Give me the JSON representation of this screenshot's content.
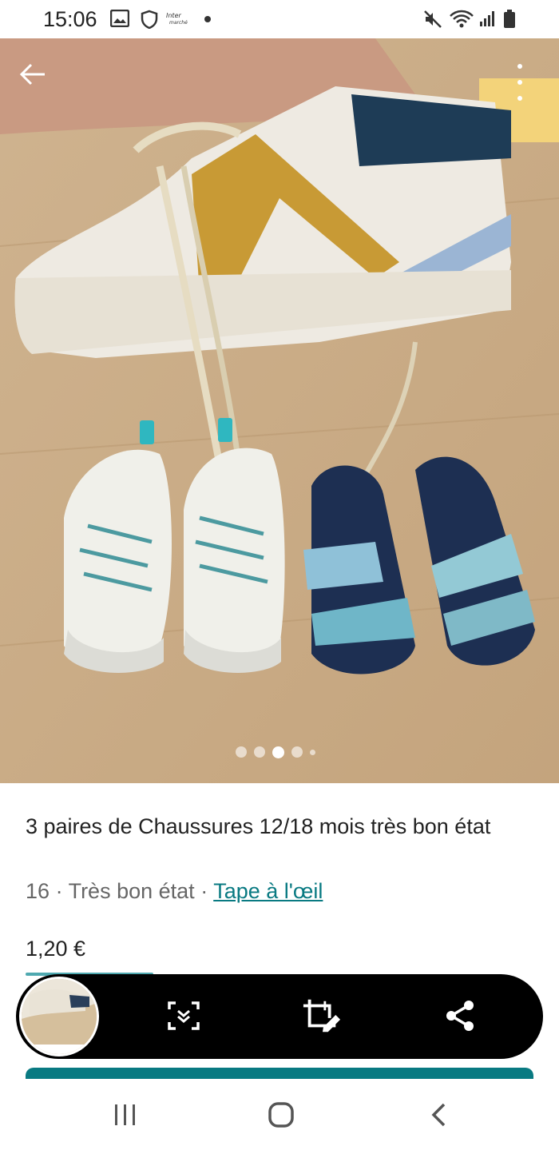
{
  "status_bar": {
    "time": "15:06",
    "icons": [
      "gallery-icon",
      "shield-icon",
      "intermarche-icon",
      "notification-dot",
      "mute-icon",
      "wifi-icon",
      "signal-icon",
      "battery-icon"
    ]
  },
  "photo": {
    "subject": "baby shoes",
    "carousel_dots": 5,
    "active_dot": 3
  },
  "item": {
    "title": "3 paires de Chaussures 12/18 mois très bon état",
    "size": "16",
    "separator": "·",
    "condition": "Très bon état",
    "brand": "Tape à l'œil",
    "price": "1,20 €"
  },
  "toolbar": {
    "icons": [
      "scroll-capture-icon",
      "crop-edit-icon",
      "share-icon"
    ]
  },
  "navbar": {
    "icons": [
      "recent-apps-icon",
      "home-icon",
      "back-icon"
    ]
  },
  "colors": {
    "accent": "#097a82",
    "toolbar": "#000000"
  }
}
